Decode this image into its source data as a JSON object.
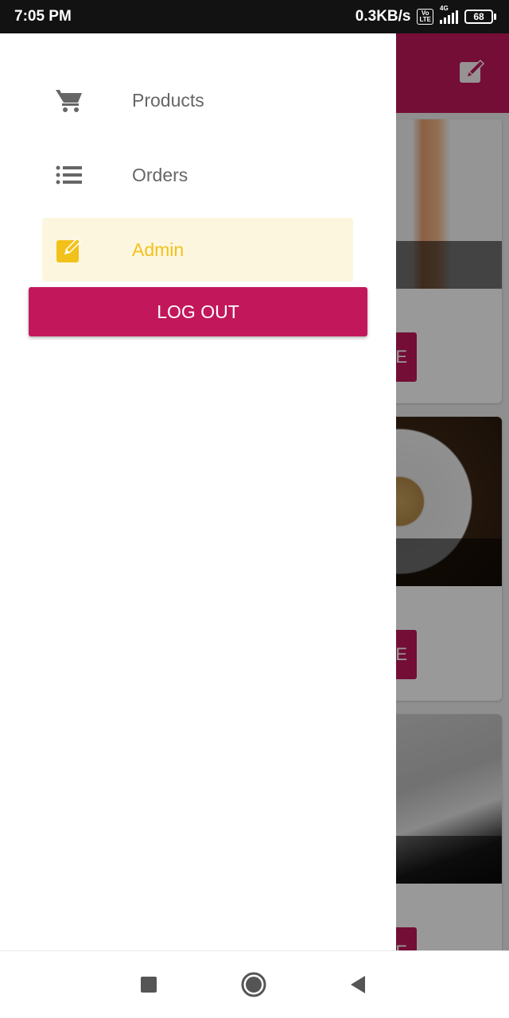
{
  "status_bar": {
    "time": "7:05 PM",
    "network_speed": "0.3KB/s",
    "volte_label": "Vo\nLTE",
    "network_type": "4G",
    "battery_level": "68"
  },
  "drawer": {
    "items": [
      {
        "label": "Products",
        "icon": "cart-icon",
        "active": false
      },
      {
        "label": "Orders",
        "icon": "list-icon",
        "active": false
      },
      {
        "label": "Admin",
        "icon": "edit-icon",
        "active": true
      }
    ],
    "logout_label": "LOG OUT"
  },
  "background_app": {
    "card_button_partial_text": "E"
  },
  "nav_bar": {
    "buttons": [
      "recent-apps-icon",
      "home-icon",
      "back-icon"
    ]
  },
  "colors": {
    "primary": "#c2185b",
    "active_accent": "#f2c21b",
    "active_background": "#fdf6df",
    "inactive_text": "#666666"
  }
}
